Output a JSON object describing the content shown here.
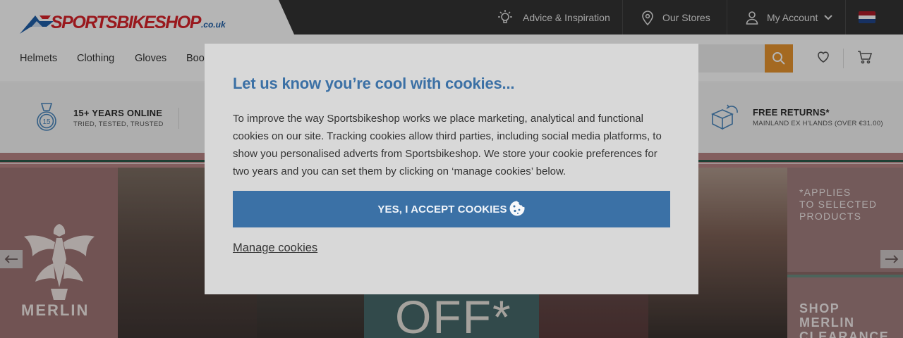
{
  "header": {
    "logo": {
      "main": "SPORTSBIKESHOP",
      "tld": ".co.uk"
    },
    "utility": [
      {
        "label": "Advice & Inspiration",
        "icon": "lightbulb-icon"
      },
      {
        "label": "Our Stores",
        "icon": "map-pin-icon"
      },
      {
        "label": "My Account",
        "icon": "user-icon"
      }
    ],
    "flag": {
      "icon": "netherlands-flag-icon",
      "colors": [
        "#ae1c28",
        "#ffffff",
        "#21468b"
      ]
    }
  },
  "nav": {
    "items": [
      "Helmets",
      "Clothing",
      "Gloves",
      "Boo"
    ],
    "search_icon": "search-icon",
    "wishlist_icon": "heart-icon",
    "cart_icon": "cart-icon",
    "accent": "#e8952f"
  },
  "usp": [
    {
      "icon": "medal-15-icon",
      "title": "15+ YEARS ONLINE",
      "sub": "TRIED, TESTED, TRUSTED"
    },
    {
      "icon": "returns-box-icon",
      "title": "FREE RETURNS*",
      "sub": "MAINLAND EX H'LANDS (OVER €31.00)"
    }
  ],
  "hero": {
    "brand": "MERLIN",
    "offer_text": "OFF*",
    "note": [
      "*APPLIES",
      "TO SELECTED",
      "PRODUCTS"
    ],
    "cta": [
      "SHOP",
      "MERLIN",
      "CLEARANCE"
    ]
  },
  "cookie_modal": {
    "title": "Let us know you’re cool with cookies...",
    "body": "To improve the way Sportsbikeshop works we place marketing, analytical and functional cookies on our site. Tracking cookies allow third parties, including social media platforms, to show you personalised adverts from Sportsbikeshop. We store your cookie preferences for two years and you can set them by clicking on ‘manage cookies’ below.",
    "accept_label": "YES, I ACCEPT COOKIES",
    "manage_label": "Manage cookies",
    "accent": "#3b71a6"
  }
}
